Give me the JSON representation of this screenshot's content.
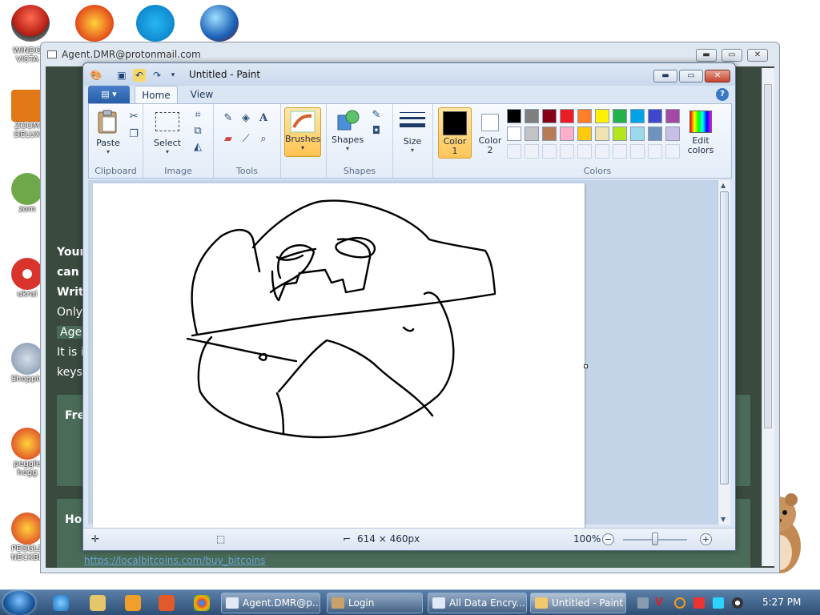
{
  "desktop": {
    "icons": [
      {
        "label": "WINDO\nVISTA",
        "color": "#c83232"
      },
      {
        "label": "ZOOM\nDELUX",
        "color": "#e07818"
      },
      {
        "label": "zom",
        "color": "#6fa84a"
      },
      {
        "label": "ukrai",
        "color": "#d8342c"
      },
      {
        "label": "Shoppin",
        "color": "#7a8ea8"
      },
      {
        "label": "peggle\nhegg",
        "color": "#e05a2a"
      },
      {
        "label": "PEGGLE\nNECKBE",
        "color": "#e05a2a"
      }
    ]
  },
  "browser": {
    "title": "Agent.DMR@protonmail.com",
    "lines": [
      {
        "text": "Your",
        "bold": true
      },
      {
        "text": "can r",
        "bold": true
      },
      {
        "text": "Writ",
        "bold": true
      },
      {
        "text": "Only",
        "bold": false
      },
      {
        "text": "Agen",
        "bold": false
      },
      {
        "text": "It is i",
        "bold": false
      },
      {
        "text": "keys",
        "bold": false
      }
    ],
    "box1_heading": "Fre",
    "box2_heading": "Hov",
    "link": "https://localbitcoins.com/buy_bitcoins"
  },
  "paint": {
    "title": "Untitled - Paint",
    "file_menu": "▤ ▾",
    "tabs": {
      "home": "Home",
      "view": "View"
    },
    "help": "?",
    "groups": {
      "clipboard": "Clipboard",
      "image": "Image",
      "tools": "Tools",
      "shapes": "Shapes",
      "colors": "Colors"
    },
    "buttons": {
      "paste": "Paste",
      "select": "Select",
      "brushes": "Brushes",
      "shapes": "Shapes",
      "size": "Size",
      "color1": "Color\n1",
      "color2": "Color\n2",
      "edit_colors": "Edit\ncolors"
    },
    "palette": [
      "#000000",
      "#7f7f7f",
      "#880015",
      "#ed1c24",
      "#ff7f27",
      "#fff200",
      "#22b14c",
      "#00a2e8",
      "#3f48cc",
      "#a349a4",
      "#ffffff",
      "#c3c3c3",
      "#b97a57",
      "#ffaec9",
      "#ffc90e",
      "#efe4b0",
      "#b5e61d",
      "#99d9ea",
      "#7092be",
      "#c8bfe7"
    ],
    "color1": "#000000",
    "color2": "#ffffff",
    "status": {
      "dimensions": "614 × 460px",
      "zoom": "100%",
      "zoom_fraction": 0.5
    }
  },
  "taskbar": {
    "items": [
      {
        "label": "Agent.DMR@p...",
        "active": false
      },
      {
        "label": "Login",
        "active": false
      },
      {
        "label": "All Data Encry...",
        "active": false
      },
      {
        "label": "Untitled - Paint",
        "active": true
      }
    ],
    "clock": "5:27 PM"
  }
}
